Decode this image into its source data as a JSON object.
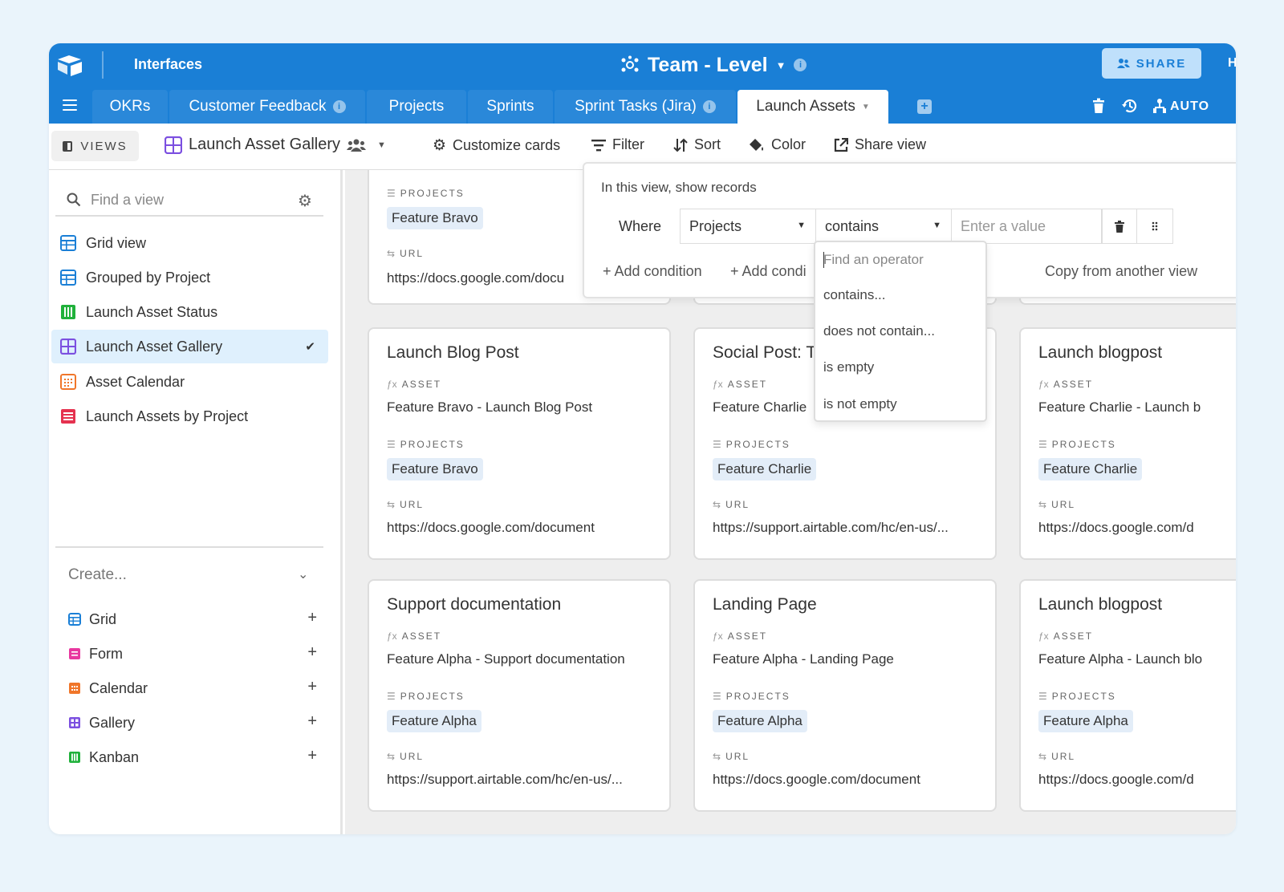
{
  "app": {
    "section": "Interfaces",
    "base_title": "Team - Level",
    "share_label": "SHARE",
    "help_label": "H",
    "auto_label": "AUTO"
  },
  "tabs": [
    {
      "label": "OKRs"
    },
    {
      "label": "Customer Feedback"
    },
    {
      "label": "Projects"
    },
    {
      "label": "Sprints"
    },
    {
      "label": "Sprint Tasks (Jira)"
    },
    {
      "label": "Launch Assets"
    }
  ],
  "viewbar": {
    "views_label": "VIEWS",
    "current_view": "Launch Asset Gallery",
    "customize_label": "Customize cards",
    "filter_label": "Filter",
    "sort_label": "Sort",
    "color_label": "Color",
    "share_view_label": "Share view"
  },
  "sidebar": {
    "find_placeholder": "Find a view",
    "views": [
      {
        "label": "Grid view",
        "icon": "grid-icon",
        "color": "#1a7fd6"
      },
      {
        "label": "Grouped by Project",
        "icon": "grid-icon",
        "color": "#1a7fd6"
      },
      {
        "label": "Launch Asset Status",
        "icon": "kanban-icon",
        "color": "#20b13b"
      },
      {
        "label": "Launch Asset Gallery",
        "icon": "gallery-icon",
        "color": "#7b4fe0",
        "selected": true
      },
      {
        "label": "Asset Calendar",
        "icon": "calendar-icon",
        "color": "#f0762a"
      },
      {
        "label": "Launch Assets by Project",
        "icon": "grouped-icon",
        "color": "#e5324f"
      }
    ],
    "create_label": "Create...",
    "create_items": [
      {
        "label": "Grid",
        "icon": "grid-icon",
        "color": "#1a7fd6"
      },
      {
        "label": "Form",
        "icon": "form-icon",
        "color": "#e8379f"
      },
      {
        "label": "Calendar",
        "icon": "calendar-icon",
        "color": "#f0762a"
      },
      {
        "label": "Gallery",
        "icon": "gallery-icon",
        "color": "#7b4fe0"
      },
      {
        "label": "Kanban",
        "icon": "kanban-icon",
        "color": "#20b13b"
      }
    ]
  },
  "field_labels": {
    "asset": "ASSET",
    "projects": "PROJECTS",
    "url": "URL"
  },
  "top_card": {
    "project": "Feature Bravo",
    "url": "https://docs.google.com/docu"
  },
  "cards": [
    {
      "title": "Launch Blog Post",
      "asset": "Feature Bravo - Launch Blog Post",
      "project": "Feature Bravo",
      "url": "https://docs.google.com/document"
    },
    {
      "title": "Social Post: T",
      "asset": "Feature Charlie",
      "project": "Feature Charlie",
      "url": "https://support.airtable.com/hc/en-us/..."
    },
    {
      "title": "Launch blogpost",
      "asset": "Feature Charlie - Launch b",
      "project": "Feature Charlie",
      "url": "https://docs.google.com/d"
    },
    {
      "title": "Support documentation",
      "asset": "Feature Alpha - Support documentation",
      "project": "Feature Alpha",
      "url": "https://support.airtable.com/hc/en-us/..."
    },
    {
      "title": "Landing Page",
      "asset": "Feature Alpha - Landing Page",
      "project": "Feature Alpha",
      "url": "https://docs.google.com/document"
    },
    {
      "title": "Launch blogpost",
      "asset": "Feature Alpha - Launch blo",
      "project": "Feature Alpha",
      "url": "https://docs.google.com/d"
    }
  ],
  "filter": {
    "header": "In this view, show records",
    "where_label": "Where",
    "field": "Projects",
    "operator": "contains",
    "value_placeholder": "Enter a value",
    "add_condition": "Add condition",
    "add_condition_group": "Add condi",
    "copy_from": "Copy from another view",
    "operator_search_placeholder": "Find an operator",
    "operators": [
      "contains...",
      "does not contain...",
      "is empty",
      "is not empty"
    ]
  }
}
